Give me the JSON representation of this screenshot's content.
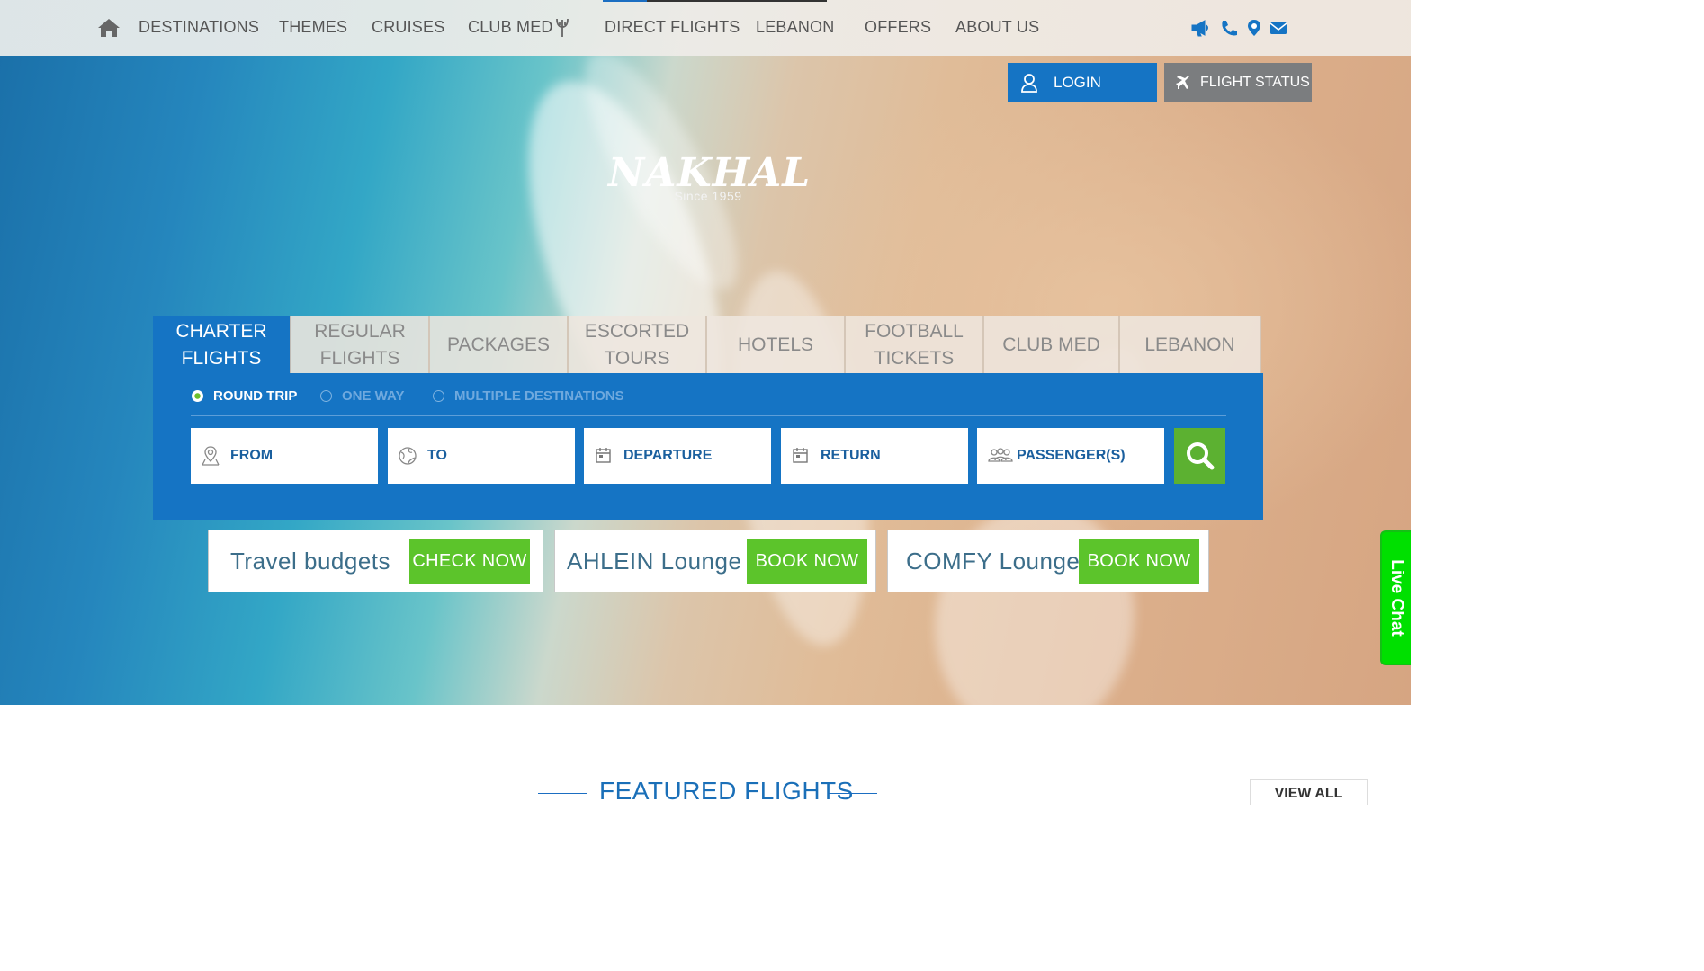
{
  "nav": {
    "items": [
      "DESTINATIONS",
      "THEMES",
      "CRUISES",
      "CLUB MED",
      "DIRECT FLIGHTS",
      "LEBANON",
      "OFFERS",
      "ABOUT US"
    ]
  },
  "header": {
    "login_label": "LOGIN",
    "flight_status_label": "FLIGHT STATUS"
  },
  "logo": {
    "name": "NAKHAL",
    "since": "Since 1959"
  },
  "search": {
    "tabs": [
      [
        "CHARTER",
        "FLIGHTS"
      ],
      [
        "REGULAR",
        "FLIGHTS"
      ],
      [
        "PACKAGES"
      ],
      [
        "ESCORTED",
        "TOURS"
      ],
      [
        "HOTELS"
      ],
      [
        "FOOTBALL",
        "TICKETS"
      ],
      [
        "CLUB MED"
      ],
      [
        "LEBANON"
      ]
    ],
    "trip_types": [
      "ROUND TRIP",
      "ONE WAY",
      "MULTIPLE DESTINATIONS"
    ],
    "fields": {
      "from": "FROM",
      "to": "TO",
      "departure": "DEPARTURE",
      "return": "RETURN",
      "passengers": "PASSENGER(S)"
    }
  },
  "promos": [
    {
      "text": "Travel budgets",
      "button": "CHECK NOW"
    },
    {
      "text": "AHLEIN Lounge",
      "button": "BOOK NOW"
    },
    {
      "text": "COMFY Lounge",
      "button": "BOOK NOW"
    }
  ],
  "live_chat": "Live Chat",
  "featured": {
    "title": "FEATURED FLIGHTS",
    "view_all": "VIEW ALL"
  },
  "colors": {
    "brand_blue": "#1574c4",
    "accent_green": "#5cc42b",
    "live_chat_green": "#00e000",
    "status_grey": "#7b7d7f"
  }
}
